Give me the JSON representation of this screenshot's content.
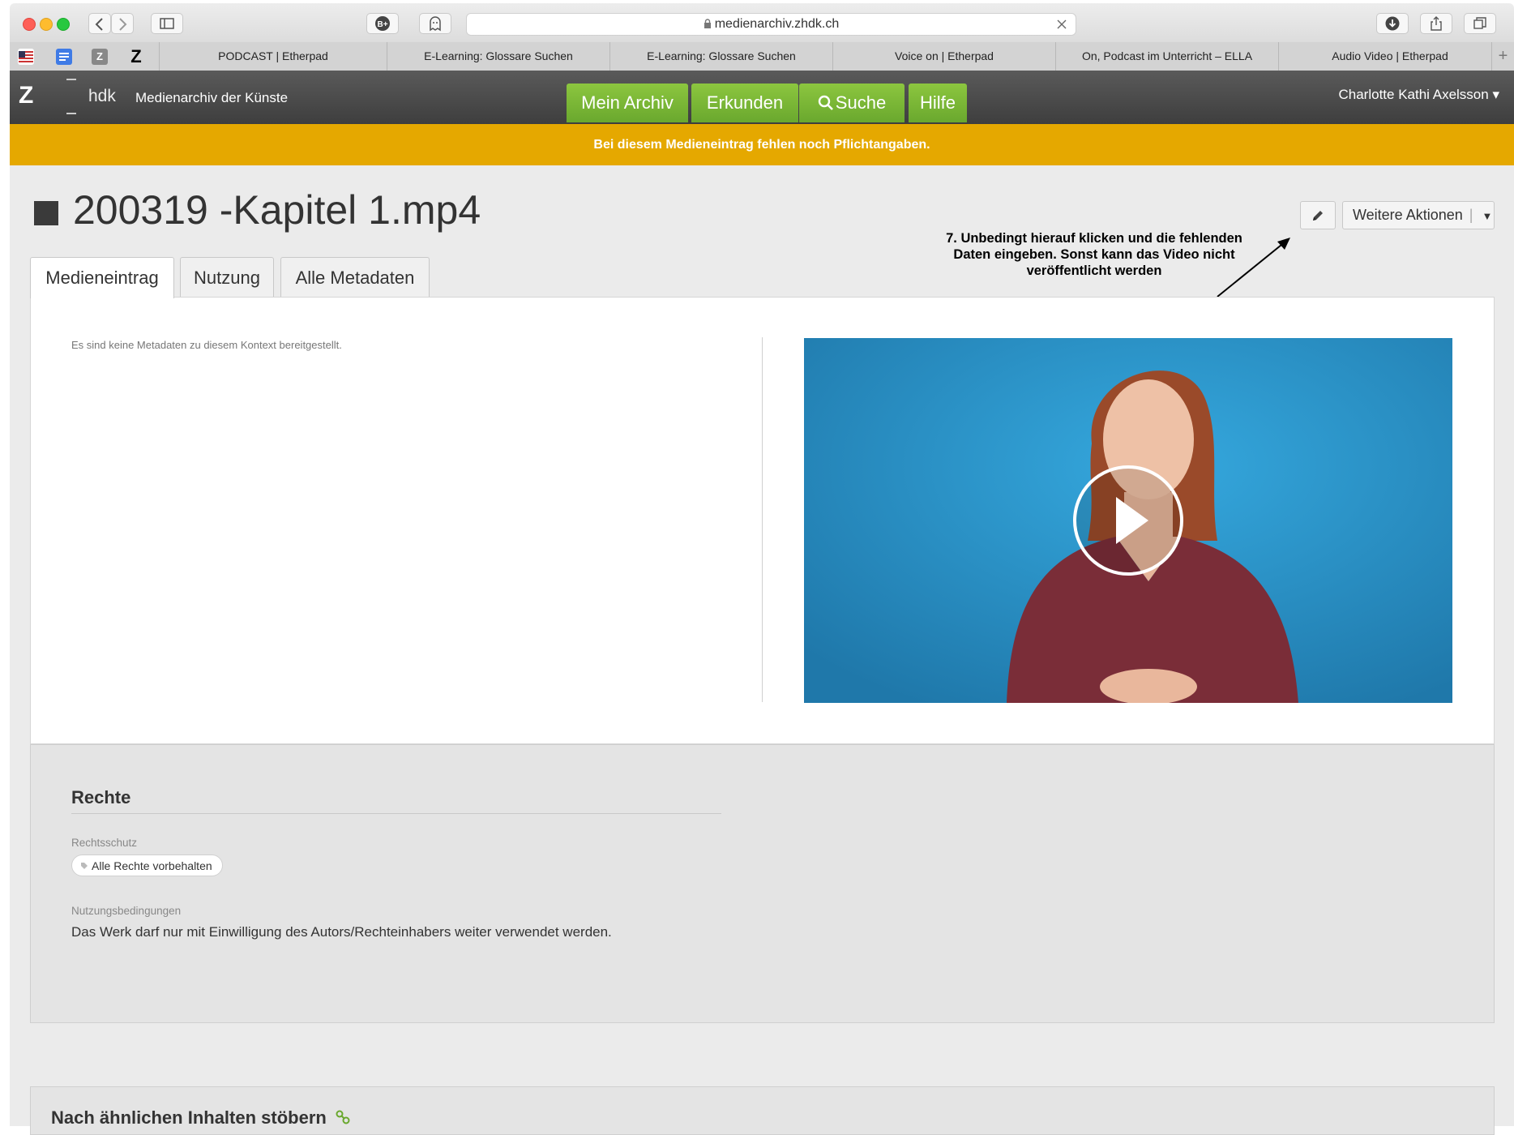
{
  "browser": {
    "url": "medienarchiv.zhdk.ch",
    "tabs": [
      {
        "label": "PODCAST | Etherpad"
      },
      {
        "label": "E-Learning: Glossare Suchen"
      },
      {
        "label": "E-Learning: Glossare Suchen"
      },
      {
        "label": "Voice on | Etherpad"
      },
      {
        "label": "On, Podcast im Unterricht – ELLA"
      },
      {
        "label": "Audio Video | Etherpad"
      }
    ],
    "new_tab": "+",
    "favicons": [
      "flag-icon",
      "docs-icon",
      "z-grey-icon",
      "z-bold-icon"
    ]
  },
  "header": {
    "logo_z": "Z",
    "logo_hdk": "hdk",
    "app_name": "Medienarchiv der Künste",
    "nav": {
      "mein_archiv": "Mein Archiv",
      "erkunden": "Erkunden",
      "suche": "Suche",
      "hilfe": "Hilfe"
    },
    "user": "Charlotte Kathi Axelsson",
    "user_caret": "▾"
  },
  "warning": "Bei diesem Medieneintrag fehlen noch Pflichtangaben.",
  "entry": {
    "title": "200319 -Kapitel 1.mp4",
    "weitere_aktionen": "Weitere Aktionen",
    "annotation": "7. Unbedingt hierauf klicken und die fehlenden Daten eingeben. Sonst kann das Video nicht veröffentlicht werden",
    "tabs": {
      "medieneintrag": "Medieneintrag",
      "nutzung": "Nutzung",
      "alle_metadaten": "Alle Metadaten"
    },
    "no_metadata": "Es sind keine Metadaten zu diesem Kontext bereitgestellt."
  },
  "rights": {
    "heading": "Rechte",
    "rechtsschutz_label": "Rechtsschutz",
    "rechtsschutz_value": "Alle Rechte vorbehalten",
    "nutzung_label": "Nutzungsbedingungen",
    "nutzung_value": "Das Werk darf nur mit Einwilligung des Autors/Rechteinhabers weiter verwendet werden."
  },
  "similar": {
    "heading": "Nach ähnlichen Inhalten stöbern"
  },
  "colors": {
    "nav_green": "#7ab835",
    "warning": "#e5a800",
    "header_dark": "#474747"
  }
}
